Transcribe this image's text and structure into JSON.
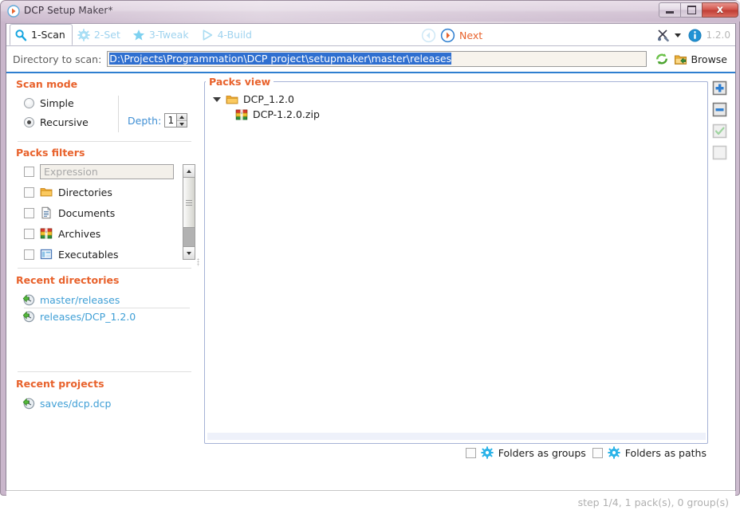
{
  "window": {
    "title": "DCP Setup Maker*",
    "app_icon": "arrow-circle-icon",
    "controls": {
      "minimize": "minimize-button",
      "maximize": "maximize-button",
      "close_glyph": "x"
    }
  },
  "navbar": {
    "tabs": [
      {
        "label": "1-Scan",
        "icon": "magnifier-icon",
        "active": true
      },
      {
        "label": "2-Set",
        "icon": "gear-icon",
        "active": false
      },
      {
        "label": "3-Tweak",
        "icon": "star-icon",
        "active": false
      },
      {
        "label": "4-Build",
        "icon": "play-icon",
        "active": false
      }
    ],
    "back_icon": "back-arrow-icon",
    "next_icon": "next-arrow-icon",
    "next_label": "Next",
    "tools_icon": "tools-icon",
    "info_icon": "info-icon",
    "version": "1.2.0"
  },
  "directory_bar": {
    "label": "Directory to scan:",
    "value": "D:\\Projects\\Programmation\\DCP project\\setupmaker\\master\\releases",
    "value_selected": true,
    "refresh_icon": "refresh-icon",
    "browse_icon": "browse-folder-icon",
    "browse_label": "Browse"
  },
  "scan_mode": {
    "title": "Scan mode",
    "options": [
      {
        "label": "Simple",
        "selected": false
      },
      {
        "label": "Recursive",
        "selected": true
      }
    ],
    "depth_label": "Depth:",
    "depth_value": "1"
  },
  "packs_filters": {
    "title": "Packs filters",
    "expression_placeholder": "Expression",
    "expression_value": "",
    "expression_checked": false,
    "items": [
      {
        "label": "Directories",
        "icon": "folder-icon",
        "checked": false
      },
      {
        "label": "Documents",
        "icon": "document-icon",
        "checked": false
      },
      {
        "label": "Archives",
        "icon": "archive-icon",
        "checked": false
      },
      {
        "label": "Executables",
        "icon": "exe-icon",
        "checked": false
      }
    ]
  },
  "recent_directories": {
    "title": "Recent directories",
    "items": [
      {
        "label": "master/releases",
        "icon": "recent-clock-icon"
      },
      {
        "label": "releases/DCP_1.2.0",
        "icon": "recent-clock-icon"
      }
    ]
  },
  "recent_projects": {
    "title": "Recent projects",
    "items": [
      {
        "label": "saves/dcp.dcp",
        "icon": "recent-clock-icon"
      }
    ]
  },
  "packs_view": {
    "title": "Packs view",
    "tree": [
      {
        "label": "DCP_1.2.0",
        "icon": "folder-icon",
        "expanded": true,
        "level": 0
      },
      {
        "label": "DCP-1.2.0.zip",
        "icon": "archive-icon",
        "expanded": false,
        "level": 1
      }
    ],
    "side_buttons": [
      {
        "name": "add-pack-button",
        "icon": "plus-square-icon",
        "enabled": true
      },
      {
        "name": "remove-pack-button",
        "icon": "minus-square-icon",
        "enabled": true
      },
      {
        "name": "check-pack-button",
        "icon": "check-square-icon",
        "enabled": false
      },
      {
        "name": "blank-pack-button",
        "icon": "blank-square-icon",
        "enabled": false
      }
    ],
    "options": [
      {
        "label": "Folders as groups",
        "icon": "gear-icon",
        "checked": false
      },
      {
        "label": "Folders as paths",
        "icon": "gear-icon",
        "checked": false
      }
    ]
  },
  "status_bar": {
    "text": "step 1/4, 1 pack(s), 0 group(s)"
  },
  "colors": {
    "accent_orange": "#e8622c",
    "link_blue": "#3f9fd6",
    "selection_blue": "#2f6fd0",
    "rule_blue": "#2f7fd0",
    "tab_inactive": "#9fd3ef",
    "status_grey": "#b0b0b0",
    "title_purple": "#cbb9cd"
  }
}
